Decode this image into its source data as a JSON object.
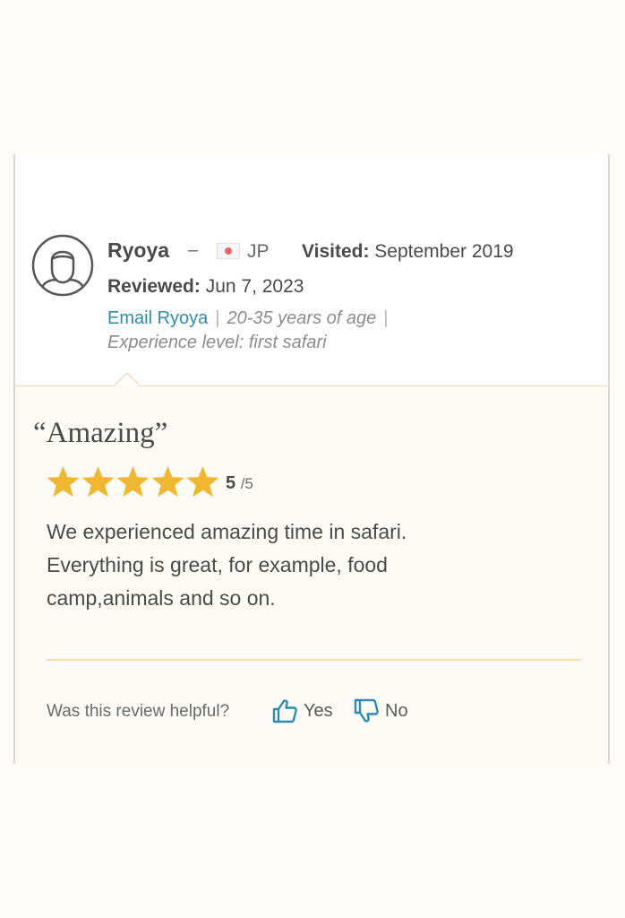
{
  "reviewer": {
    "name": "Ryoya",
    "separator": "–",
    "country_code": "JP",
    "visited_label": "Visited:",
    "visited_value": " September 2019",
    "reviewed_label": "Reviewed:",
    "reviewed_value": " Jun 7, 2023",
    "email_link": "Email Ryoya",
    "age_range": "20-35 years of age",
    "experience": "Experience level: first safari"
  },
  "review": {
    "title": "“Amazing”",
    "rating": "5",
    "rating_max": "/5",
    "rating_value": 5,
    "body": "We experienced amazing time in safari.\nEverything is great, for example, food\ncamp,animals and so on."
  },
  "helpful": {
    "question": "Was this review helpful?",
    "yes_label": "Yes",
    "no_label": "No"
  },
  "colors": {
    "link": "#2b8cae",
    "star": "#f0b730",
    "divider": "#f0dfae",
    "icon": "#2b8cae"
  },
  "icons": {
    "avatar": "user-avatar-icon",
    "star": "star-icon",
    "yes": "thumbs-up-icon",
    "no": "thumbs-down-icon"
  }
}
